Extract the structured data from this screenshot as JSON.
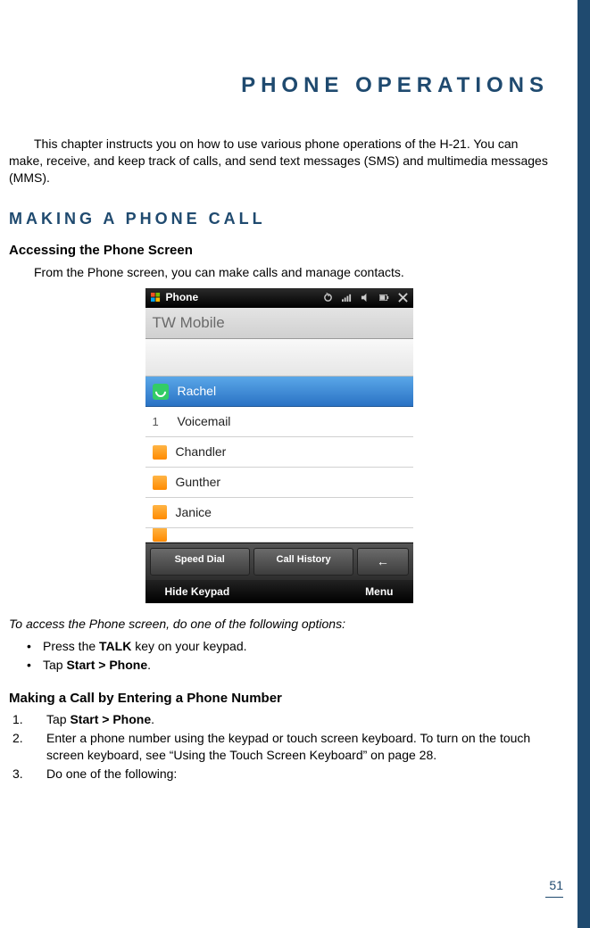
{
  "chapter_title": "Phone Operations",
  "intro": "This chapter instructs you on how to use various phone operations of the H-21. You can make, receive, and keep track of calls, and send text messages (SMS) and multimedia messages (MMS).",
  "section1": {
    "heading": "Making a Phone Call",
    "sub1_title": "Accessing the Phone Screen",
    "sub1_text": "From the Phone screen, you can make calls and manage contacts.",
    "access_line": "To access the Phone screen, do one of the following options:",
    "bullets": {
      "b1_pre": "Press the ",
      "b1_strong": "TALK",
      "b1_post": " key on your keypad.",
      "b2_pre": "Tap ",
      "b2_strong": "Start > Phone",
      "b2_post": "."
    },
    "sub2_title": "Making a Call by Entering a Phone Number",
    "steps": {
      "s1_pre": "Tap ",
      "s1_strong": "Start > Phone",
      "s1_post": ".",
      "s2": "Enter a phone number using the keypad or touch screen keyboard. To turn on the touch screen keyboard, see “Using the Touch Screen Keyboard” on page 28.",
      "s3": "Do one of the following:"
    }
  },
  "phone": {
    "status_title": "Phone",
    "carrier": "TW Mobile",
    "rows": [
      {
        "label": "Rachel",
        "selected": true,
        "icon": "call"
      },
      {
        "label": "Voicemail",
        "num": "1"
      },
      {
        "label": "Chandler",
        "icon": "orange"
      },
      {
        "label": "Gunther",
        "icon": "orange"
      },
      {
        "label": "Janice",
        "icon": "orange"
      }
    ],
    "partial_row_icon": "orange",
    "buttons": {
      "b1": "Speed Dial",
      "b2": "Call History",
      "b3": "←"
    },
    "bottom": {
      "left": "Hide Keypad",
      "right": "Menu"
    }
  },
  "page_number": "51"
}
